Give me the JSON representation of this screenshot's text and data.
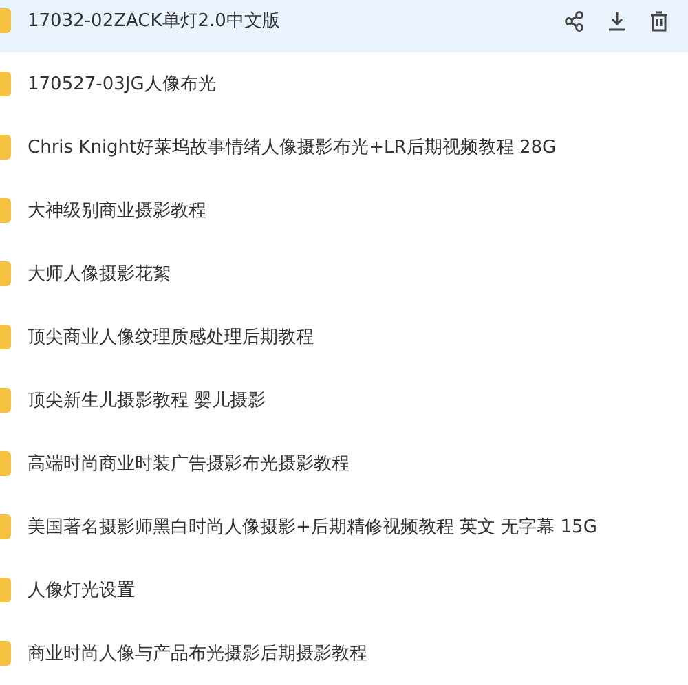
{
  "files": [
    {
      "name": "17032-02ZACK单灯2.0中文版",
      "selected": true
    },
    {
      "name": "170527-03JG人像布光",
      "selected": false
    },
    {
      "name": "Chris Knight好莱坞故事情绪人像摄影布光+LR后期视频教程 28G",
      "selected": false
    },
    {
      "name": "大神级别商业摄影教程",
      "selected": false
    },
    {
      "name": "大师人像摄影花絮",
      "selected": false
    },
    {
      "name": "顶尖商业人像纹理质感处理后期教程",
      "selected": false
    },
    {
      "name": "顶尖新生儿摄影教程 婴儿摄影",
      "selected": false
    },
    {
      "name": "高端时尚商业时装广告摄影布光摄影教程",
      "selected": false
    },
    {
      "name": "美国著名摄影师黑白时尚人像摄影+后期精修视频教程 英文 无字幕 15G",
      "selected": false
    },
    {
      "name": "人像灯光设置",
      "selected": false
    },
    {
      "name": "商业时尚人像与产品布光摄影后期摄影教程",
      "selected": false
    }
  ]
}
